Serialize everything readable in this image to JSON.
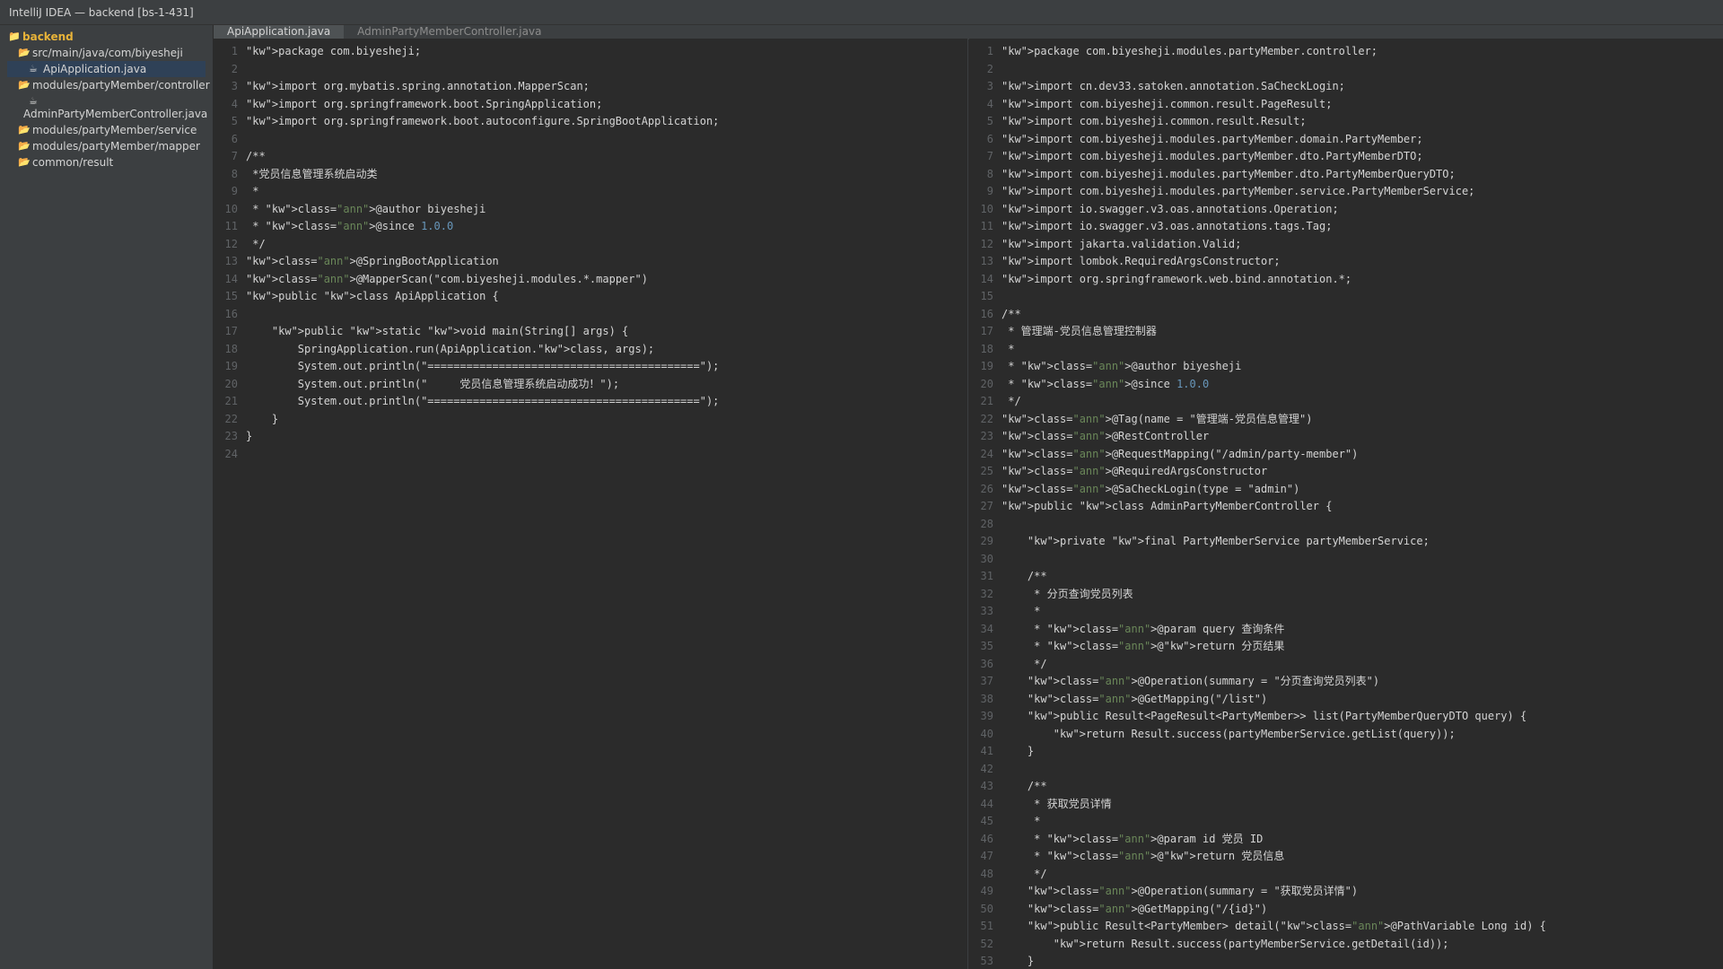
{
  "window": {
    "title": "IntelliJ IDEA — backend [bs-1-431]"
  },
  "sidebar": {
    "root": "backend",
    "items": [
      {
        "label": "src/main/java/com/biyesheji",
        "level": 1,
        "icon": "folder-icon"
      },
      {
        "label": "ApiApplication.java",
        "level": 2,
        "icon": "java-file-icon",
        "selected": true
      },
      {
        "label": "modules/partyMember/controller",
        "level": 1,
        "icon": "folder-icon"
      },
      {
        "label": "AdminPartyMemberController.java",
        "level": 2,
        "icon": "java-file-icon",
        "wrapped": true
      },
      {
        "label": "modules/partyMember/service",
        "level": 1,
        "icon": "folder-icon"
      },
      {
        "label": "modules/partyMember/mapper",
        "level": 1,
        "icon": "folder-icon"
      },
      {
        "label": "common/result",
        "level": 1,
        "icon": "folder-icon"
      }
    ]
  },
  "tabs": [
    {
      "label": "ApiApplication.java",
      "active": true
    },
    {
      "label": "AdminPartyMemberController.java",
      "active": false
    }
  ],
  "left_editor": {
    "lines": [
      "\"kw\">package com.biyesheji;",
      "",
      "\"kw\">import org.mybatis.spring.annotation.MapperScan;",
      "\"kw\">import org.springframework.boot.SpringApplication;",
      "\"kw\">import org.springframework.boot.autoconfigure.SpringBootApplication;",
      "",
      "/**",
      " *党员信息管理系统启动类",
      " *",
      " * \"kw\">class=\"ann\">@author biyesheji",
      " * \"kw\">class=\"ann\">@since 1.0.0",
      " */",
      "\"kw\">class=\"ann\">@SpringBootApplication",
      "\"kw\">class=\"ann\">@MapperScan(\"com.biyesheji.modules.*.mapper\")",
      "\"kw\">public \"kw\">class ApiApplication {",
      "",
      "    \"kw\">public \"kw\">static \"kw\">void main(String[] args) {",
      "        SpringApplication.run(ApiApplication.\"kw\">class, args);",
      "        System.out.println(\"==========================================\");",
      "        System.out.println(\"     党员信息管理系统启动成功！\");",
      "        System.out.println(\"==========================================\");",
      "    }",
      "}",
      ""
    ]
  },
  "right_editor": {
    "lines": [
      "\"kw\">package com.biyesheji.modules.partyMember.controller;",
      "",
      "\"kw\">import cn.dev33.satoken.annotation.SaCheckLogin;",
      "\"kw\">import com.biyesheji.common.result.PageResult;",
      "\"kw\">import com.biyesheji.common.result.Result;",
      "\"kw\">import com.biyesheji.modules.partyMember.domain.PartyMember;",
      "\"kw\">import com.biyesheji.modules.partyMember.dto.PartyMemberDTO;",
      "\"kw\">import com.biyesheji.modules.partyMember.dto.PartyMemberQueryDTO;",
      "\"kw\">import com.biyesheji.modules.partyMember.service.PartyMemberService;",
      "\"kw\">import io.swagger.v3.oas.annotations.Operation;",
      "\"kw\">import io.swagger.v3.oas.annotations.tags.Tag;",
      "\"kw\">import jakarta.validation.Valid;",
      "\"kw\">import lombok.RequiredArgsConstructor;",
      "\"kw\">import org.springframework.web.bind.annotation.*;",
      "",
      "/**",
      " * 管理端-党员信息管理控制器",
      " *",
      " * \"kw\">class=\"ann\">@author biyesheji",
      " * \"kw\">class=\"ann\">@since 1.0.0",
      " */",
      "\"kw\">class=\"ann\">@Tag(name = \"管理端-党员信息管理\")",
      "\"kw\">class=\"ann\">@RestController",
      "\"kw\">class=\"ann\">@RequestMapping(\"/admin/party-member\")",
      "\"kw\">class=\"ann\">@RequiredArgsConstructor",
      "\"kw\">class=\"ann\">@SaCheckLogin(type = \"admin\")",
      "\"kw\">public \"kw\">class AdminPartyMemberController {",
      "",
      "    \"kw\">private \"kw\">final PartyMemberService partyMemberService;",
      "",
      "    /**",
      "     * 分页查询党员列表",
      "     *",
      "     * \"kw\">class=\"ann\">@param query 查询条件",
      "     * \"kw\">class=\"ann\">@\"kw\">return 分页结果",
      "     */",
      "    \"kw\">class=\"ann\">@Operation(summary = \"分页查询党员列表\")",
      "    \"kw\">class=\"ann\">@GetMapping(\"/list\")",
      "    \"kw\">public Result<PageResult<PartyMember>> list(PartyMemberQueryDTO query) {",
      "        \"kw\">return Result.success(partyMemberService.getList(query));",
      "    }",
      "",
      "    /**",
      "     * 获取党员详情",
      "     *",
      "     * \"kw\">class=\"ann\">@param id 党员 ID",
      "     * \"kw\">class=\"ann\">@\"kw\">return 党员信息",
      "     */",
      "    \"kw\">class=\"ann\">@Operation(summary = \"获取党员详情\")",
      "    \"kw\">class=\"ann\">@GetMapping(\"/{id}\")",
      "    \"kw\">public Result<PartyMember> detail(\"kw\">class=\"ann\">@PathVariable Long id) {",
      "        \"kw\">return Result.success(partyMemberService.getDetail(id));",
      "    }"
    ]
  },
  "colors": {
    "text": "#d4d4d4",
    "annotation": "#6a8759",
    "number": "#6897bb",
    "line_number": "#606366",
    "folder": "#e8b339",
    "selection": "#2f4157"
  }
}
